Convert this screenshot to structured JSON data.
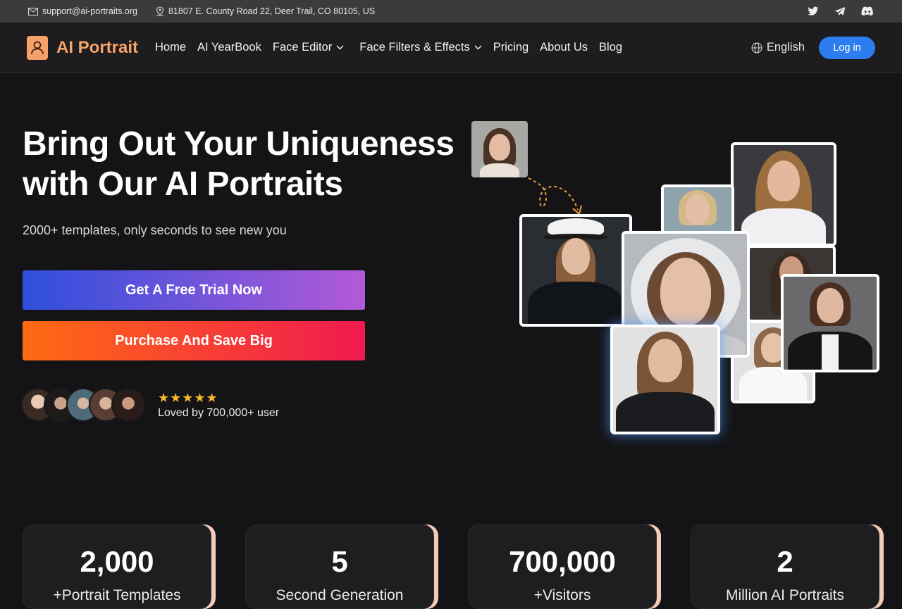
{
  "topbar": {
    "email": "support@ai-portraits.org",
    "address": "81807 E. County Road 22, Deer Trail, CO 80105, US",
    "social": [
      "twitter-icon",
      "telegram-icon",
      "discord-icon"
    ]
  },
  "nav": {
    "brand": "AI Portrait",
    "items": [
      {
        "label": "Home"
      },
      {
        "label": "AI YearBook"
      },
      {
        "label": "Face Editor"
      },
      {
        "label": "Face Filters & Effects"
      },
      {
        "label": "Pricing"
      },
      {
        "label": "About Us"
      },
      {
        "label": "Blog"
      }
    ],
    "language": "English",
    "login": "Log in"
  },
  "hero": {
    "title_line1": "Bring Out Your Uniqueness",
    "title_line2": "with Our AI Portraits",
    "subtitle": "2000+ templates, only seconds to see new you",
    "cta_primary": "Get A Free Trial Now",
    "cta_secondary": "Purchase And Save Big",
    "stars": "★★★★★",
    "loved": "Loved by 700,000+ user"
  },
  "stats": [
    {
      "value": "2,000",
      "label": "+Portrait Templates"
    },
    {
      "value": "5",
      "label": "Second Generation"
    },
    {
      "value": "700,000",
      "label": "+Visitors"
    },
    {
      "value": "2",
      "label": "Million AI Portraits"
    }
  ],
  "colors": {
    "accent_orange": "#f7a366",
    "login_blue": "#2c7ef0",
    "star_gold": "#f7b928"
  }
}
